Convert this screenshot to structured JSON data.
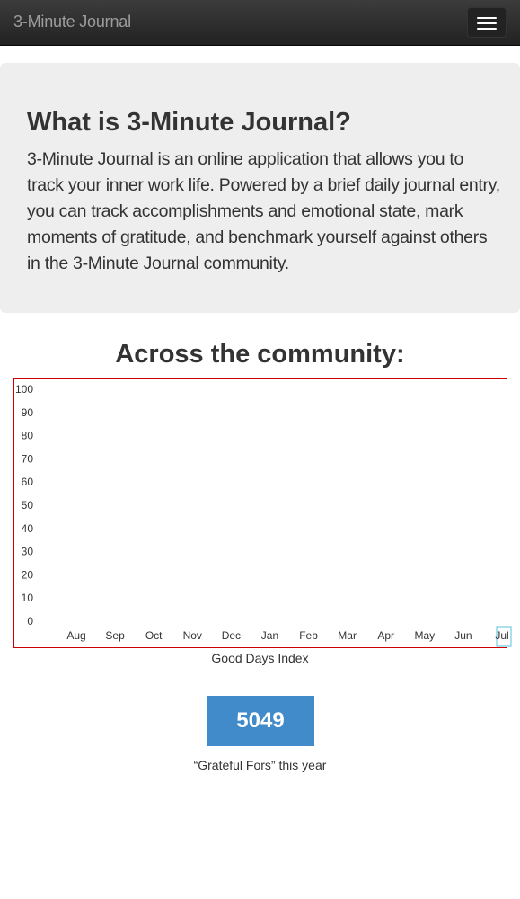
{
  "navbar": {
    "brand": "3-Minute Journal",
    "menu_icon": "hamburger-menu-icon"
  },
  "intro": {
    "title": "What is 3-Minute Journal?",
    "body": "3-Minute Journal is an online application that allows you to track your inner work life. Powered by a brief daily journal entry, you can track accomplishments and emotional state, mark moments of gratitude, and benchmark yourself against others in the 3-Minute Journal community."
  },
  "community": {
    "title": "Across the community:",
    "chart_caption": "Good Days Index",
    "grateful_count": "5049",
    "grateful_label": "“Grateful Fors” this year"
  },
  "chart_data": {
    "type": "line",
    "categories": [
      "Aug",
      "Sep",
      "Oct",
      "Nov",
      "Dec",
      "Jan",
      "Feb",
      "Mar",
      "Apr",
      "May",
      "Jun",
      "Jul"
    ],
    "series": [],
    "ylim": [
      0,
      100
    ],
    "yticks": [
      0,
      10,
      20,
      30,
      40,
      50,
      60,
      70,
      80,
      90,
      100
    ],
    "grid": false,
    "highlighted_category": "Jul",
    "title": "",
    "xlabel": "",
    "ylabel": ""
  },
  "colors": {
    "navbar": "#222222",
    "brand_text": "#9d9d9d",
    "jumbotron_bg": "#eeeeee",
    "chart_border": "#cc0000",
    "highlight_box": "#5bc0de",
    "stat_box": "#428bca"
  }
}
